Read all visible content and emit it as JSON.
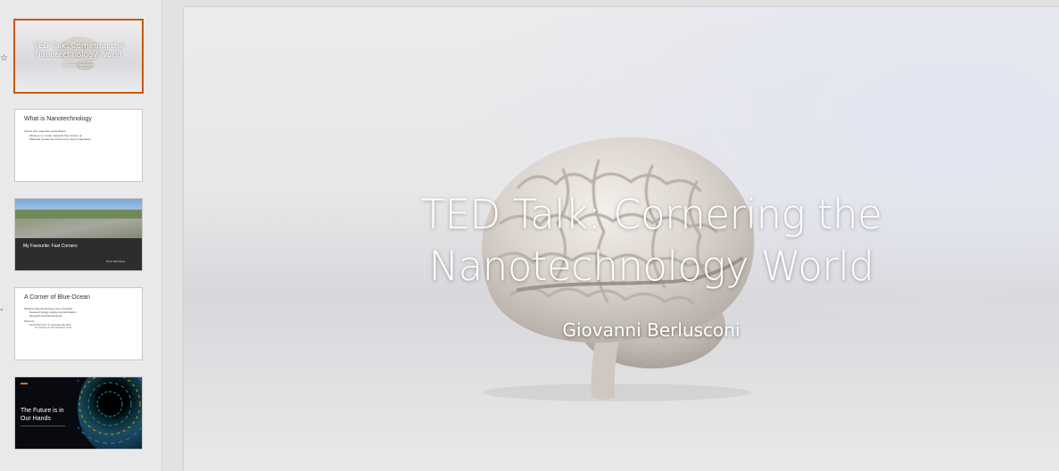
{
  "thumbnails": [
    {
      "number": "",
      "title": "TED Talk: Cornering the Nanotechnology World",
      "subtitle": "Giovanni Berlusconi",
      "selected": true
    },
    {
      "number": "",
      "title": "What is Nanotechnology",
      "bullets": [
        "Atomic and molecular manipulation",
        "Allows us to create materials from bottom up",
        "Materials created are limited only user's imagination"
      ]
    },
    {
      "number": "",
      "title": "My Favourite: Fast Corners",
      "caption": "Photo: Aldo Kaleva"
    },
    {
      "number": "",
      "title": "A Corner of Blue Ocean",
      "bullets": [
        "Tackling Nanotechnology's key strengths",
        "Nanotechnology scaling and fabrication",
        "Research and Development",
        "Partners",
        "Good Tech Inc' is covering the ship",
        "Our working up with fabrication Good"
      ]
    },
    {
      "number": "",
      "title": "The Future is in Our Hands"
    }
  ],
  "slide": {
    "title": "TED Talk: Cornering the Nanotechnology World",
    "subtitle": "Giovanni Berlusconi"
  },
  "colors": {
    "selection": "#c55a11",
    "accent_orange": "#e8710a"
  }
}
